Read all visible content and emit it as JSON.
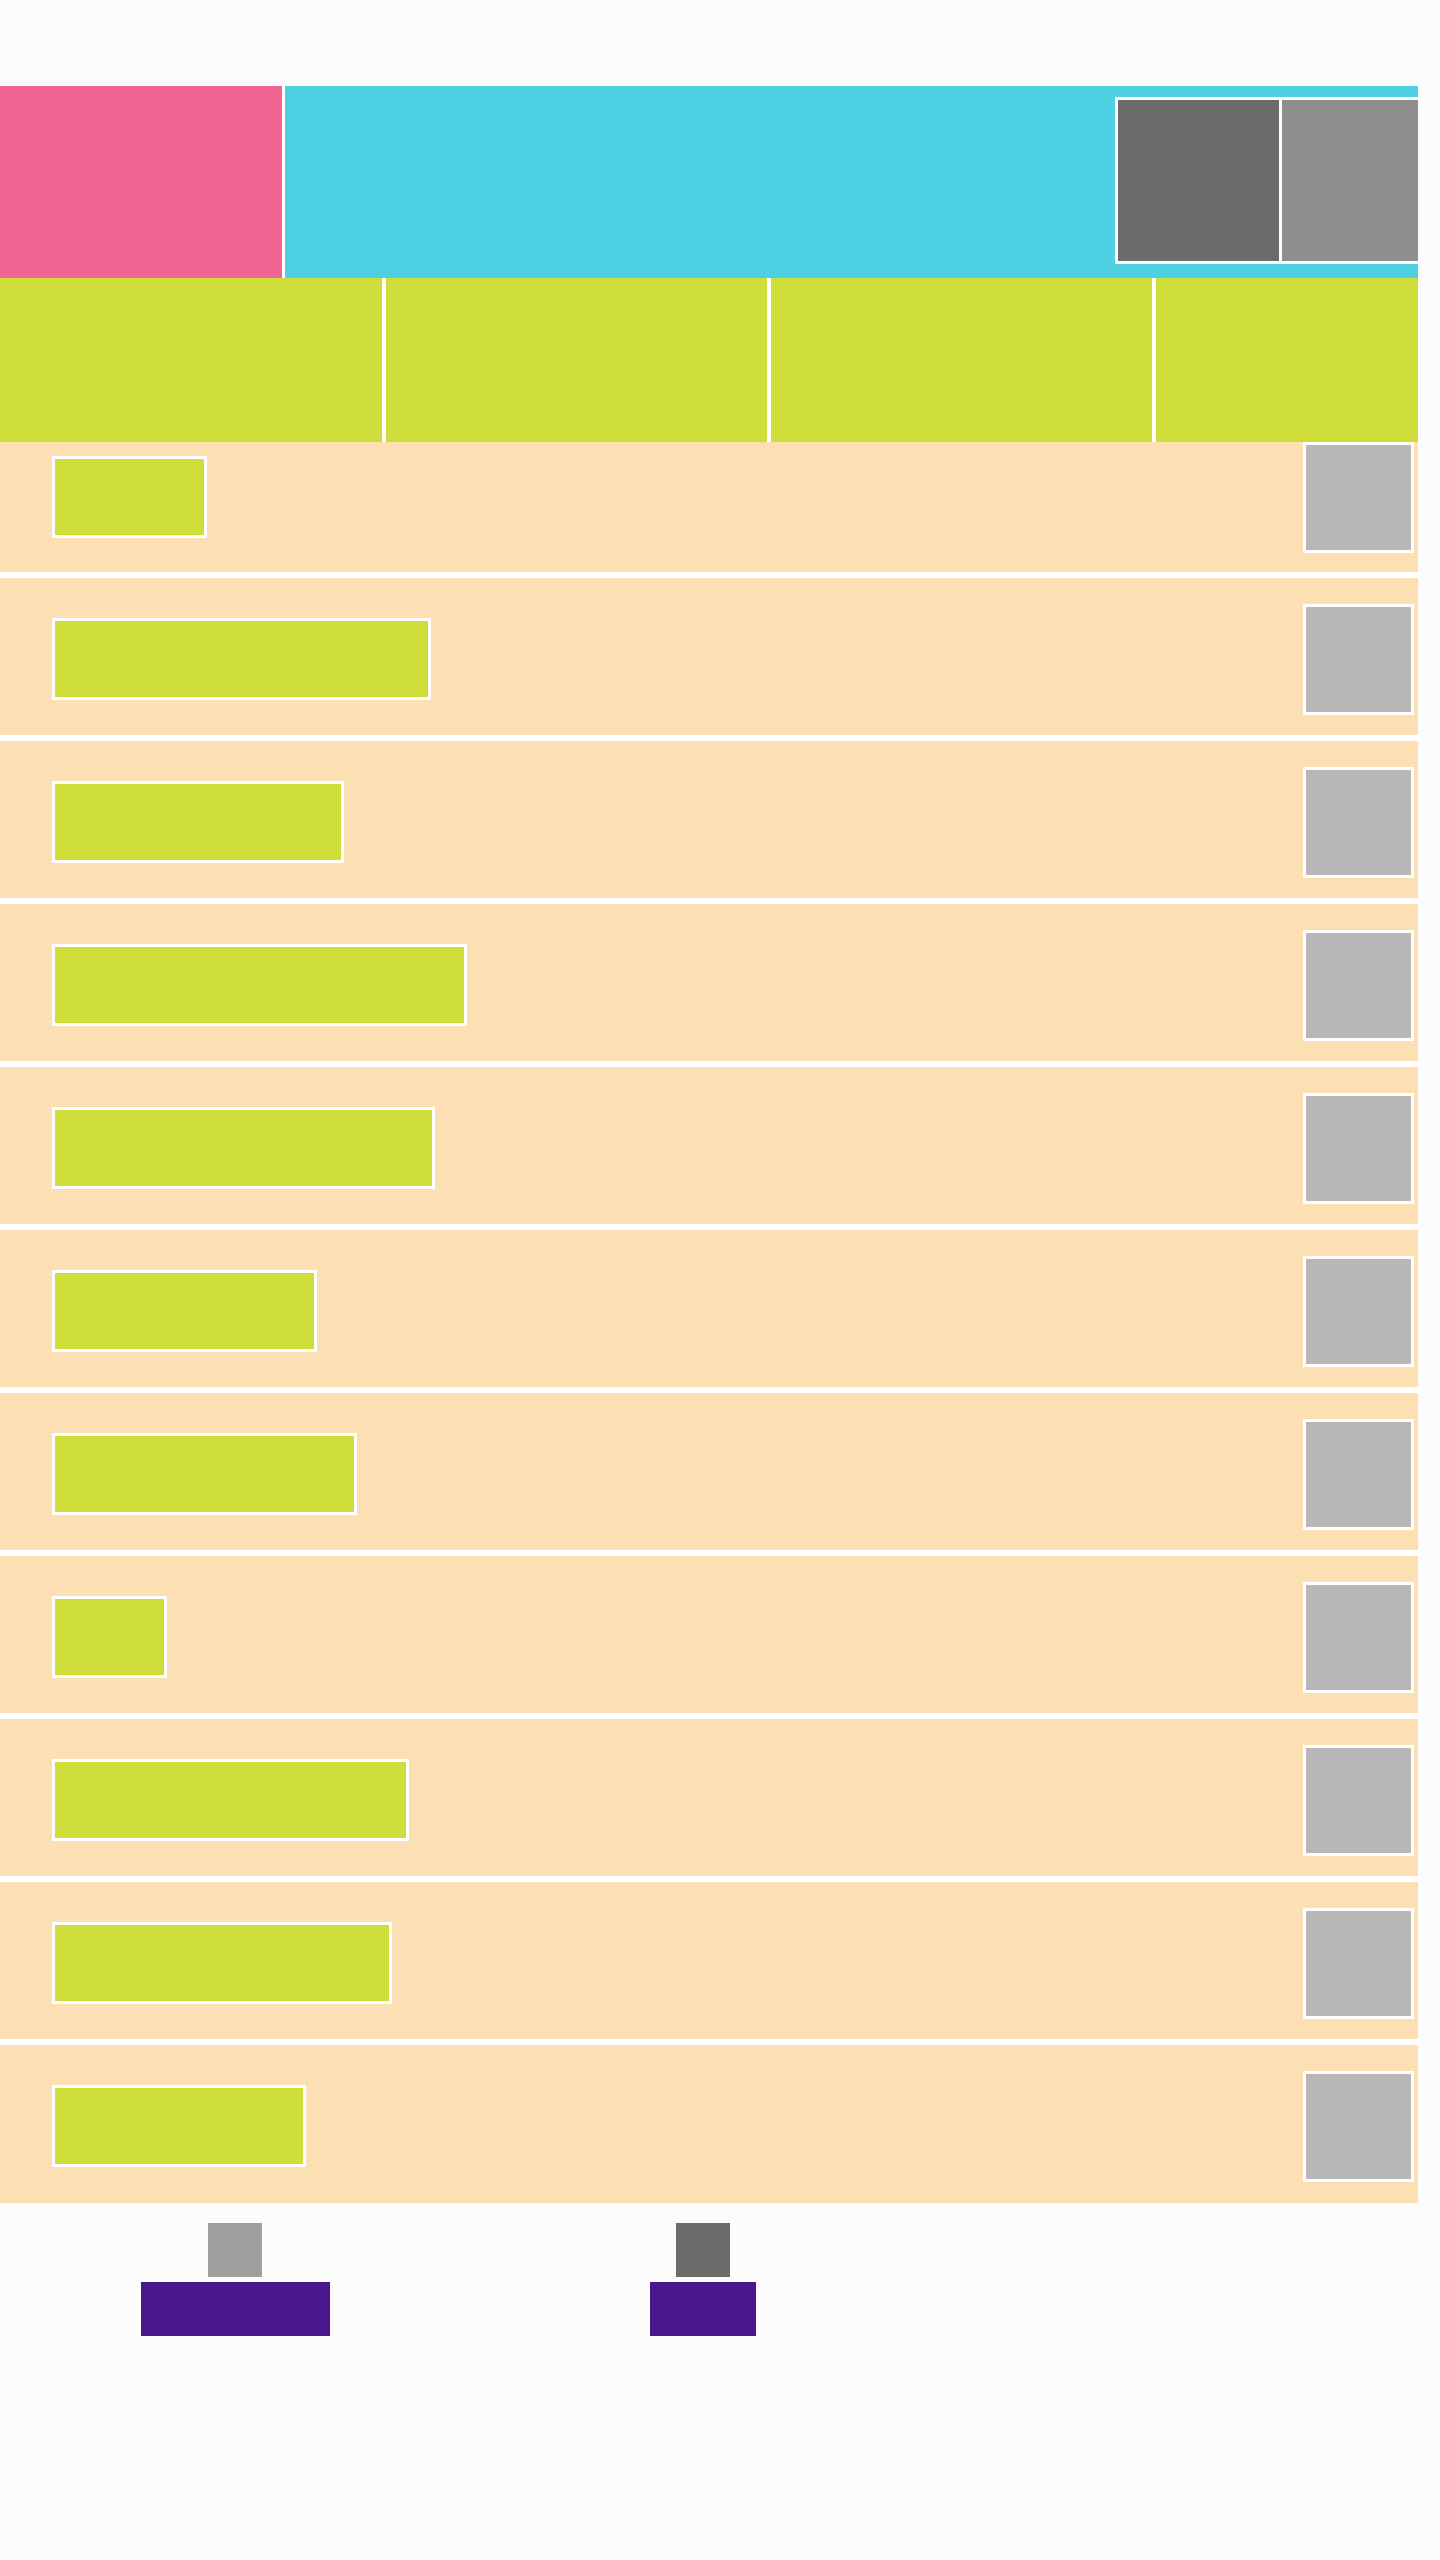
{
  "colors": {
    "page_bg": "#fdfcfc",
    "logo": "#f06592",
    "header": "#4dd0e2",
    "action_dark": "#6b6b6b",
    "action_mid": "#8e8e8e",
    "tab": "#cfdd3a",
    "row_bg": "#fcdfb2",
    "row_label": "#cfdd3a",
    "row_action": "#b8b6b6",
    "page_icon_light": "#9e9e9e",
    "page_icon_dark": "#6b6b6b",
    "page_label": "#4a168c"
  },
  "header": {
    "title": "",
    "logo_icon": "app-logo",
    "actions": [
      {
        "name": "action-1",
        "icon": "square-icon",
        "label": ""
      },
      {
        "name": "action-2",
        "icon": "square-icon",
        "label": ""
      }
    ]
  },
  "tabs": [
    {
      "label": ""
    },
    {
      "label": ""
    },
    {
      "label": ""
    },
    {
      "label": ""
    }
  ],
  "list": {
    "items": [
      {
        "label": "",
        "action_icon": "thumbnail-icon"
      },
      {
        "label": "",
        "action_icon": "thumbnail-icon"
      },
      {
        "label": "",
        "action_icon": "thumbnail-icon"
      },
      {
        "label": "",
        "action_icon": "thumbnail-icon"
      },
      {
        "label": "",
        "action_icon": "thumbnail-icon"
      },
      {
        "label": "",
        "action_icon": "thumbnail-icon"
      },
      {
        "label": "",
        "action_icon": "thumbnail-icon"
      },
      {
        "label": "",
        "action_icon": "thumbnail-icon"
      },
      {
        "label": "",
        "action_icon": "thumbnail-icon"
      },
      {
        "label": "",
        "action_icon": "thumbnail-icon"
      },
      {
        "label": "",
        "action_icon": "thumbnail-icon"
      }
    ]
  },
  "bottom_nav": [
    {
      "icon": "square-icon",
      "label": ""
    },
    {
      "icon": "square-icon",
      "label": ""
    }
  ]
}
